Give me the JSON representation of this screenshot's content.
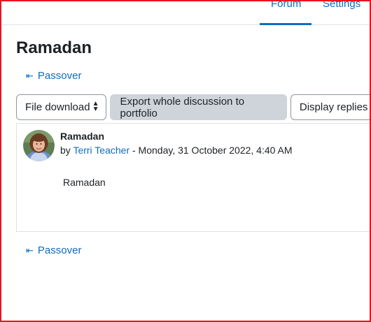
{
  "tabs": {
    "forum": "Forum",
    "settings": "Settings"
  },
  "page": {
    "title": "Ramadan"
  },
  "nav": {
    "prev_top_label": "Passover",
    "prev_bottom_label": "Passover",
    "arrow_icon": "arrow-left-to-line-icon"
  },
  "toolbar": {
    "download_select": "File download",
    "export_button": "Export whole discussion to portfolio",
    "display_select": "Display replies"
  },
  "post": {
    "subject": "Ramadan",
    "by": "by",
    "author": "Terri Teacher",
    "date": " - Monday, 31 October 2022, 4:40 AM",
    "body": "Ramadan"
  },
  "colors": {
    "link": "#0f6cbf",
    "frame": "#e8141f",
    "button_bg": "#ced4da"
  }
}
